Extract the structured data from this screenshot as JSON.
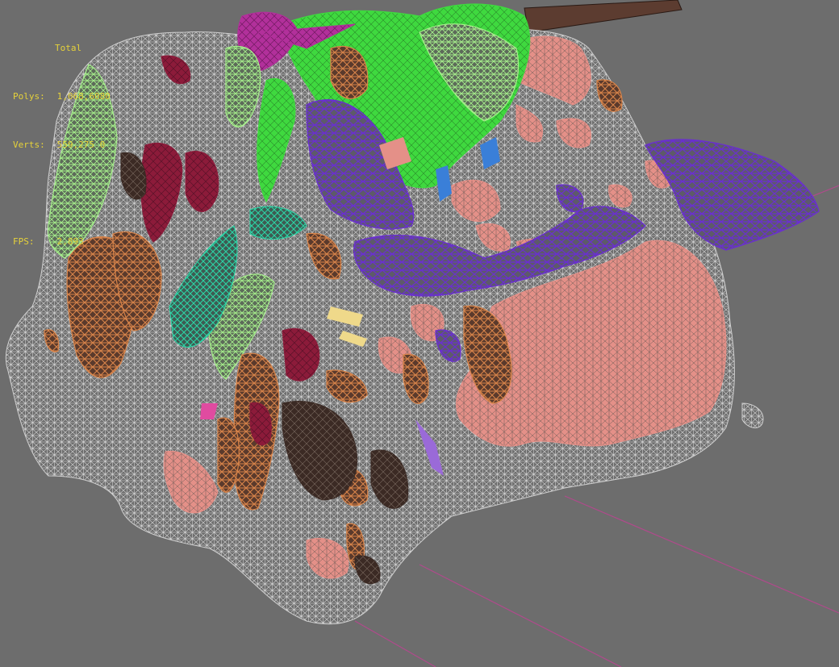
{
  "viewport": {
    "name": "3D wireframe viewport",
    "background": "#6d6d6d",
    "wire_colors": {
      "base_mesh": "#d8d8d8",
      "salmon": "#e49088",
      "purple": "#6a2fd0",
      "green": "#3fd93f",
      "light_green": "#a6f08c",
      "orange": "#d8844a",
      "maroon": "#8c1b3a",
      "teal": "#2bb89a",
      "magenta": "#b2309b",
      "dark_brown": "#3b2a24",
      "grid_line": "#b04a8c",
      "plank": "#5c3c30"
    }
  },
  "stats": {
    "title": "Total",
    "polys_label": "Polys:",
    "polys_value": "1,068,6080",
    "verts_label": "Verts:",
    "verts_value": "559,275 0",
    "fps_label": "FPS:",
    "fps_value": "2.893"
  }
}
